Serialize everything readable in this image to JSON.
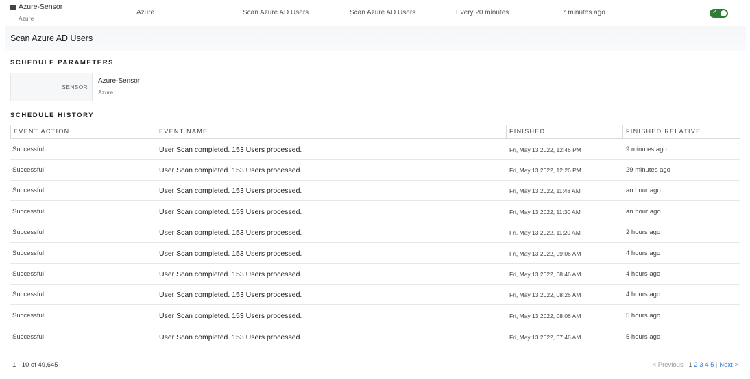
{
  "schedule_row": {
    "sensor_name": "Azure-Sensor",
    "sensor_type": "Azure",
    "platform": "Azure",
    "action": "Scan Azure AD Users",
    "name": "Scan Azure AD Users",
    "frequency": "Every 20 minutes",
    "last_run": "7 minutes ago",
    "enabled": true,
    "toggle_color": "#2e7d32"
  },
  "detail": {
    "title": "Scan Azure AD Users",
    "params_heading": "SCHEDULE PARAMETERS",
    "sensor_label": "SENSOR",
    "sensor_value": "Azure-Sensor",
    "sensor_sub": "Azure",
    "history_heading": "SCHEDULE HISTORY"
  },
  "history": {
    "columns": [
      "EVENT ACTION",
      "EVENT NAME",
      "FINISHED",
      "FINISHED RELATIVE"
    ],
    "rows": [
      {
        "action": "Successful",
        "name": "User Scan completed. 153 Users processed.",
        "finished": "Fri, May 13 2022, 12:46 PM",
        "relative": "9 minutes ago"
      },
      {
        "action": "Successful",
        "name": "User Scan completed. 153 Users processed.",
        "finished": "Fri, May 13 2022, 12:26 PM",
        "relative": "29 minutes ago"
      },
      {
        "action": "Successful",
        "name": "User Scan completed. 153 Users processed.",
        "finished": "Fri, May 13 2022, 11:48 AM",
        "relative": "an hour ago"
      },
      {
        "action": "Successful",
        "name": "User Scan completed. 153 Users processed.",
        "finished": "Fri, May 13 2022, 11:30 AM",
        "relative": "an hour ago"
      },
      {
        "action": "Successful",
        "name": "User Scan completed. 153 Users processed.",
        "finished": "Fri, May 13 2022, 11:20 AM",
        "relative": "2 hours ago"
      },
      {
        "action": "Successful",
        "name": "User Scan completed. 153 Users processed.",
        "finished": "Fri, May 13 2022, 09:06 AM",
        "relative": "4 hours ago"
      },
      {
        "action": "Successful",
        "name": "User Scan completed. 153 Users processed.",
        "finished": "Fri, May 13 2022, 08:46 AM",
        "relative": "4 hours ago"
      },
      {
        "action": "Successful",
        "name": "User Scan completed. 153 Users processed.",
        "finished": "Fri, May 13 2022, 08:26 AM",
        "relative": "4 hours ago"
      },
      {
        "action": "Successful",
        "name": "User Scan completed. 153 Users processed.",
        "finished": "Fri, May 13 2022, 08:06 AM",
        "relative": "5 hours ago"
      },
      {
        "action": "Successful",
        "name": "User Scan completed. 153 Users processed.",
        "finished": "Fri, May 13 2022, 07:46 AM",
        "relative": "5 hours ago"
      }
    ]
  },
  "pagination": {
    "range_text": "1 - 10 of 49,645",
    "previous": "< Previous",
    "pages": [
      "1",
      "2",
      "3",
      "4",
      "5"
    ],
    "next": "Next >",
    "current_page": "1"
  }
}
